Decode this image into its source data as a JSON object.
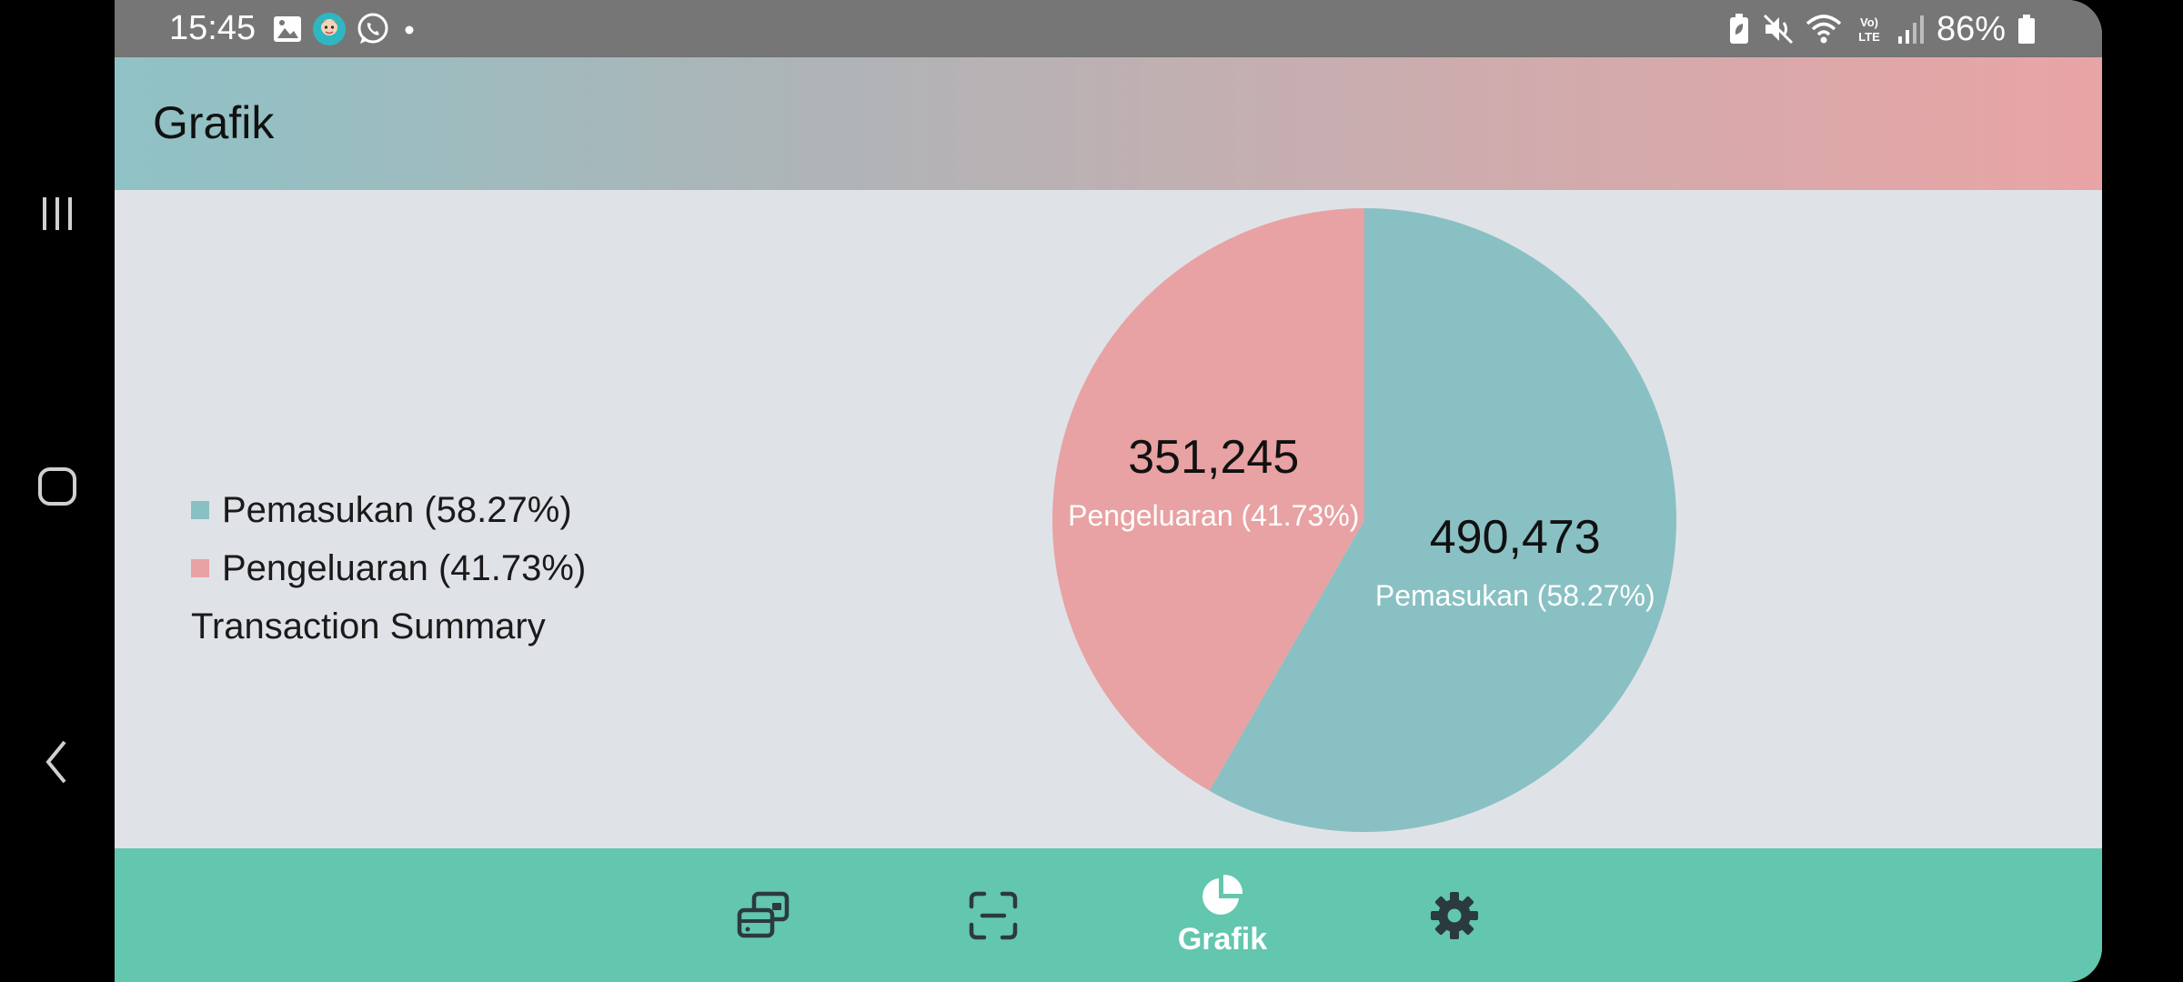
{
  "status_bar": {
    "time": "15:45",
    "battery_percent": "86%",
    "left_icons": [
      "gallery-icon",
      "avatar-app-icon",
      "whatsapp-icon",
      "dot-icon"
    ],
    "right_icons": [
      "battery-saver-icon",
      "mute-icon",
      "wifi-icon",
      "volte-icon",
      "signal-icon",
      "battery-icon"
    ]
  },
  "app_bar": {
    "title": "Grafik"
  },
  "legend": {
    "items": [
      {
        "label": "Pemasukan (58.27%)",
        "color": "#89c0c3"
      },
      {
        "label": "Pengeluaran (41.73%)",
        "color": "#e8a2a3"
      }
    ],
    "title": "Transaction Summary"
  },
  "chart_data": {
    "type": "pie",
    "title": "Transaction Summary",
    "slices": [
      {
        "label": "Pemasukan (58.27%)",
        "value": 490473,
        "value_text": "490,473",
        "percent": 58.27,
        "color": "#89c0c3"
      },
      {
        "label": "Pengeluaran (41.73%)",
        "value": 351245,
        "value_text": "351,245",
        "percent": 41.73,
        "color": "#e8a2a3"
      }
    ],
    "legend_position": "left"
  },
  "bottom_nav": {
    "items": [
      {
        "icon": "transactions-icon",
        "label": ""
      },
      {
        "icon": "scan-icon",
        "label": ""
      },
      {
        "icon": "pie-chart-icon",
        "label": "Grafik",
        "active": true
      },
      {
        "icon": "settings-icon",
        "label": ""
      }
    ]
  },
  "colors": {
    "status_bar": "#767676",
    "app_bar_start": "#8fc2c6",
    "app_bar_end": "#e9a4a5",
    "content_bg": "#dfe3e7",
    "bottom_nav": "#63c6ae",
    "icon_dark": "#2b3a3e"
  }
}
